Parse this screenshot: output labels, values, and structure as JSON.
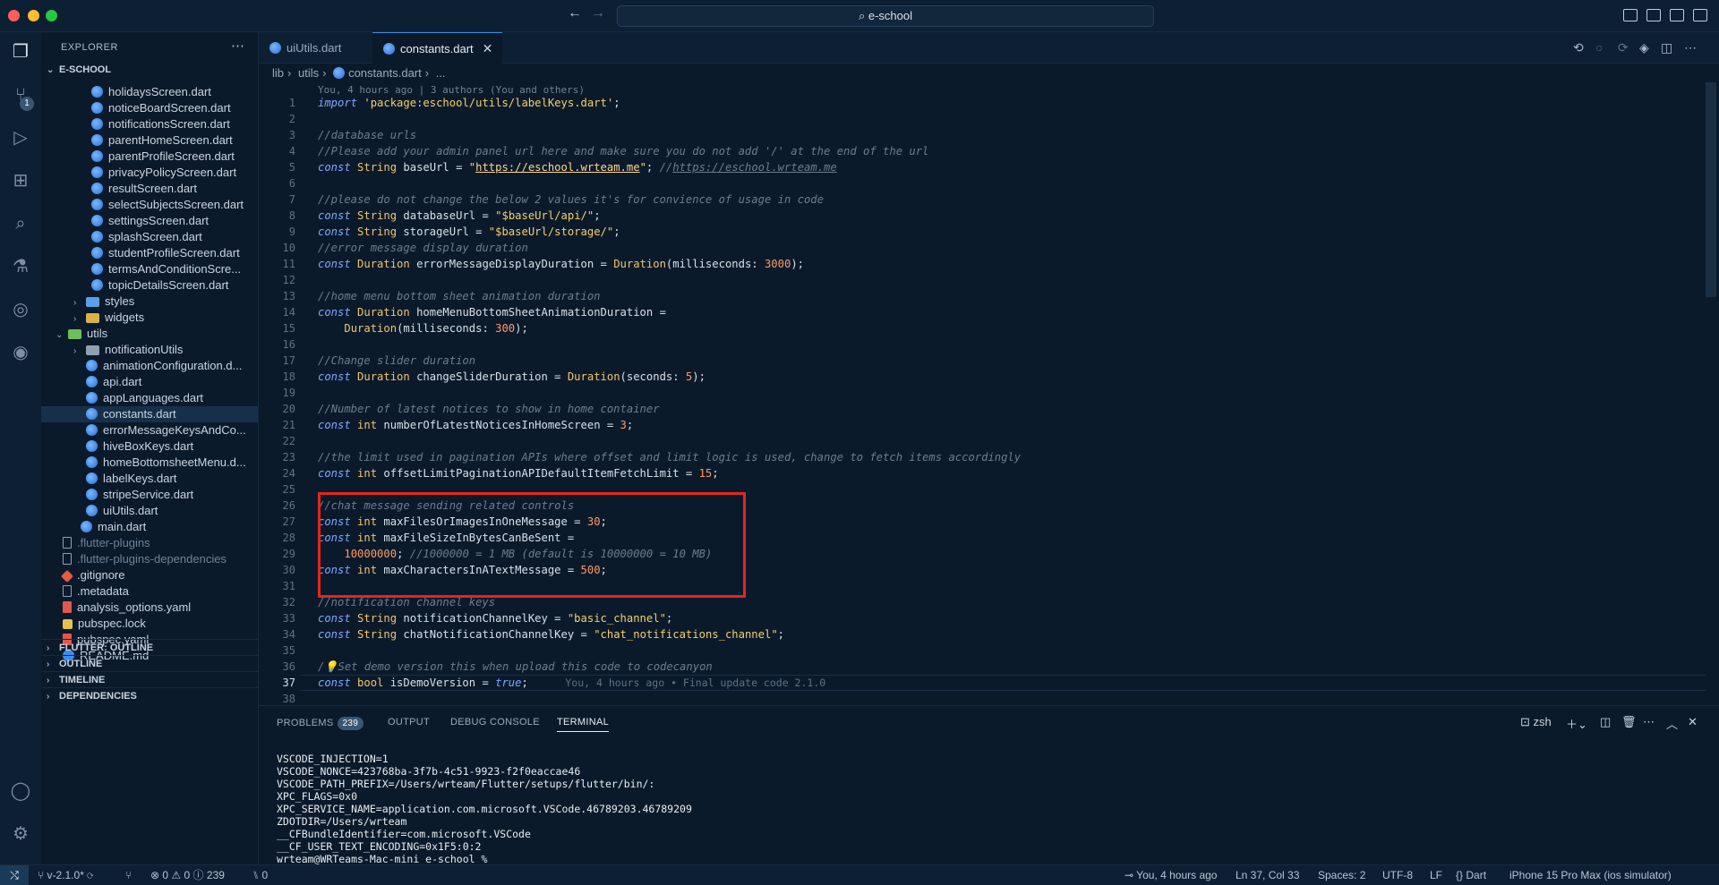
{
  "window": {
    "search": "e-school"
  },
  "explorer": {
    "title": "EXPLORER",
    "root": "E-SCHOOL",
    "items": [
      {
        "label": "holidaysScreen.dart",
        "kind": "dart",
        "indent": 2
      },
      {
        "label": "noticeBoardScreen.dart",
        "kind": "dart",
        "indent": 2
      },
      {
        "label": "notificationsScreen.dart",
        "kind": "dart",
        "indent": 2
      },
      {
        "label": "parentHomeScreen.dart",
        "kind": "dart",
        "indent": 2
      },
      {
        "label": "parentProfileScreen.dart",
        "kind": "dart",
        "indent": 2
      },
      {
        "label": "privacyPolicyScreen.dart",
        "kind": "dart",
        "indent": 2
      },
      {
        "label": "resultScreen.dart",
        "kind": "dart",
        "indent": 2
      },
      {
        "label": "selectSubjectsScreen.dart",
        "kind": "dart",
        "indent": 2
      },
      {
        "label": "settingsScreen.dart",
        "kind": "dart",
        "indent": 2
      },
      {
        "label": "splashScreen.dart",
        "kind": "dart",
        "indent": 2
      },
      {
        "label": "studentProfileScreen.dart",
        "kind": "dart",
        "indent": 2
      },
      {
        "label": "termsAndConditionScre...",
        "kind": "dart",
        "indent": 2
      },
      {
        "label": "topicDetailsScreen.dart",
        "kind": "dart",
        "indent": 2
      },
      {
        "label": "styles",
        "kind": "folder-blue",
        "indent": 1,
        "chev": "›"
      },
      {
        "label": "widgets",
        "kind": "folder-yellow",
        "indent": 1,
        "chev": "›"
      },
      {
        "label": "utils",
        "kind": "folder-green",
        "indent": 0,
        "chev": "⌄"
      },
      {
        "label": "notificationUtils",
        "kind": "folder-gray",
        "indent": 1,
        "chev": "›"
      },
      {
        "label": "animationConfiguration.d...",
        "kind": "dart",
        "indent": 1
      },
      {
        "label": "api.dart",
        "kind": "dart",
        "indent": 1
      },
      {
        "label": "appLanguages.dart",
        "kind": "dart",
        "indent": 1
      },
      {
        "label": "constants.dart",
        "kind": "dart",
        "indent": 1,
        "selected": true
      },
      {
        "label": "errorMessageKeysAndCo...",
        "kind": "dart",
        "indent": 1
      },
      {
        "label": "hiveBoxKeys.dart",
        "kind": "dart",
        "indent": 1
      },
      {
        "label": "homeBottomsheetMenu.d...",
        "kind": "dart",
        "indent": 1
      },
      {
        "label": "labelKeys.dart",
        "kind": "dart",
        "indent": 1
      },
      {
        "label": "stripeService.dart",
        "kind": "dart",
        "indent": 1
      },
      {
        "label": "uiUtils.dart",
        "kind": "dart",
        "indent": 1
      },
      {
        "label": "main.dart",
        "kind": "dart",
        "indent": -1
      },
      {
        "label": ".flutter-plugins",
        "kind": "doc",
        "indent": -2,
        "dim": true
      },
      {
        "label": ".flutter-plugins-dependencies",
        "kind": "doc",
        "indent": -2,
        "dim": true
      },
      {
        "label": ".gitignore",
        "kind": "git",
        "indent": -2
      },
      {
        "label": ".metadata",
        "kind": "doc",
        "indent": -2
      },
      {
        "label": "analysis_options.yaml",
        "kind": "red",
        "indent": -2
      },
      {
        "label": "pubspec.lock",
        "kind": "lock",
        "indent": -2
      },
      {
        "label": "pubspec.yaml",
        "kind": "red",
        "indent": -2
      },
      {
        "label": "README.md",
        "kind": "info",
        "indent": -2
      }
    ],
    "sections": [
      "FLUTTER: OUTLINE",
      "OUTLINE",
      "TIMELINE",
      "DEPENDENCIES"
    ]
  },
  "tabs": [
    {
      "label": "uiUtils.dart"
    },
    {
      "label": "constants.dart",
      "close": "✕"
    }
  ],
  "breadcrumb": [
    "lib",
    "utils",
    "constants.dart",
    "..."
  ],
  "editor": {
    "blame_top": "You, 4 hours ago | 3 authors (You and others)",
    "current_line": 37,
    "lines": [
      [
        [
          "kw",
          "import "
        ],
        [
          "str",
          "'package:eschool/utils/labelKeys.dart'"
        ],
        [
          "",
          ";"
        ]
      ],
      [],
      [
        [
          "cmt",
          "//database urls"
        ]
      ],
      [
        [
          "cmt",
          "//Please add your admin panel url here and make sure you do not add '/' at the end of the url"
        ]
      ],
      [
        [
          "kw",
          "const "
        ],
        [
          "ty",
          "String "
        ],
        [
          "",
          "baseUrl = "
        ],
        [
          "strb",
          "\""
        ],
        [
          "strb url",
          "https://eschool.wrteam.me"
        ],
        [
          "strb",
          "\""
        ],
        [
          "",
          "; "
        ],
        [
          "cmt",
          "//"
        ],
        [
          "cmt url",
          "https://eschool.wrteam.me"
        ]
      ],
      [],
      [
        [
          "cmt",
          "//please do not change the below 2 values it's for convience of usage in code"
        ]
      ],
      [
        [
          "kw",
          "const "
        ],
        [
          "ty",
          "String "
        ],
        [
          "",
          "databaseUrl = "
        ],
        [
          "str",
          "\"$baseUrl/api/\""
        ],
        [
          "",
          ";"
        ]
      ],
      [
        [
          "kw",
          "const "
        ],
        [
          "ty",
          "String "
        ],
        [
          "",
          "storageUrl = "
        ],
        [
          "str",
          "\"$baseUrl/storage/\""
        ],
        [
          "",
          ";"
        ]
      ],
      [
        [
          "cmt",
          "//error message display duration"
        ]
      ],
      [
        [
          "kw",
          "const "
        ],
        [
          "ty",
          "Duration "
        ],
        [
          "",
          "errorMessageDisplayDuration = "
        ],
        [
          "fn",
          "Duration"
        ],
        [
          "",
          "(milliseconds: "
        ],
        [
          "num",
          "3000"
        ],
        [
          "",
          ");"
        ]
      ],
      [],
      [
        [
          "cmt",
          "//home menu bottom sheet animation duration"
        ]
      ],
      [
        [
          "kw",
          "const "
        ],
        [
          "ty",
          "Duration "
        ],
        [
          "",
          "homeMenuBottomSheetAnimationDuration ="
        ]
      ],
      [
        [
          "",
          "    "
        ],
        [
          "fn",
          "Duration"
        ],
        [
          "",
          "(milliseconds: "
        ],
        [
          "num",
          "300"
        ],
        [
          "",
          ");"
        ]
      ],
      [],
      [
        [
          "cmt",
          "//Change slider duration"
        ]
      ],
      [
        [
          "kw",
          "const "
        ],
        [
          "ty",
          "Duration "
        ],
        [
          "",
          "changeSliderDuration = "
        ],
        [
          "fn",
          "Duration"
        ],
        [
          "",
          "(seconds: "
        ],
        [
          "num",
          "5"
        ],
        [
          "",
          ");"
        ]
      ],
      [],
      [
        [
          "cmt",
          "//Number of latest notices to show in home container"
        ]
      ],
      [
        [
          "kw",
          "const "
        ],
        [
          "ty",
          "int "
        ],
        [
          "",
          "numberOfLatestNoticesInHomeScreen = "
        ],
        [
          "num",
          "3"
        ],
        [
          "",
          ";"
        ]
      ],
      [],
      [
        [
          "cmt",
          "//the limit used in pagination APIs where offset and limit logic is used, change to fetch items accordingly"
        ]
      ],
      [
        [
          "kw",
          "const "
        ],
        [
          "ty",
          "int "
        ],
        [
          "",
          "offsetLimitPaginationAPIDefaultItemFetchLimit = "
        ],
        [
          "num",
          "15"
        ],
        [
          "",
          ";"
        ]
      ],
      [],
      [
        [
          "cmt",
          "//chat message sending related controls"
        ]
      ],
      [
        [
          "kw",
          "const "
        ],
        [
          "ty",
          "int "
        ],
        [
          "",
          "maxFilesOrImagesInOneMessage = "
        ],
        [
          "num",
          "30"
        ],
        [
          "",
          ";"
        ]
      ],
      [
        [
          "kw",
          "const "
        ],
        [
          "ty",
          "int "
        ],
        [
          "",
          "maxFileSizeInBytesCanBeSent ="
        ]
      ],
      [
        [
          "",
          "    "
        ],
        [
          "num",
          "10000000"
        ],
        [
          "",
          "; "
        ],
        [
          "cmt",
          "//1000000 = 1 MB (default is 10000000 = 10 MB)"
        ]
      ],
      [
        [
          "kw",
          "const "
        ],
        [
          "ty",
          "int "
        ],
        [
          "",
          "maxCharactersInATextMessage = "
        ],
        [
          "num",
          "500"
        ],
        [
          "",
          ";"
        ]
      ],
      [],
      [
        [
          "cmt",
          "//notification channel keys"
        ]
      ],
      [
        [
          "kw",
          "const "
        ],
        [
          "ty",
          "String "
        ],
        [
          "",
          "notificationChannelKey = "
        ],
        [
          "str",
          "\"basic_channel\""
        ],
        [
          "",
          ";"
        ]
      ],
      [
        [
          "kw",
          "const "
        ],
        [
          "ty",
          "String "
        ],
        [
          "",
          "chatNotificationChannelKey = "
        ],
        [
          "str",
          "\"chat_notifications_channel\""
        ],
        [
          "",
          ";"
        ]
      ],
      [],
      [
        [
          "cmt",
          "/💡Set demo version this when upload this code to codecanyon"
        ]
      ],
      [
        [
          "kw",
          "const "
        ],
        [
          "ty",
          "bool "
        ],
        [
          "",
          "isDemoVersion = "
        ],
        [
          "kw",
          "true"
        ],
        [
          "",
          ";"
        ],
        [
          "blame-inline",
          "      You, 4 hours ago • Final update code 2.1.0"
        ]
      ],
      []
    ]
  },
  "panel": {
    "tabs": [
      "PROBLEMS",
      "OUTPUT",
      "DEBUG CONSOLE",
      "TERMINAL"
    ],
    "problems_count": "239",
    "shell": "zsh",
    "terminal_lines": [
      "VSCODE_INJECTION=1",
      "VSCODE_NONCE=423768ba-3f7b-4c51-9923-f2f0eaccae46",
      "VSCODE_PATH_PREFIX=/Users/wrteam/Flutter/setups/flutter/bin/:",
      "XPC_FLAGS=0x0",
      "XPC_SERVICE_NAME=application.com.microsoft.VSCode.46789203.46789209",
      "ZDOTDIR=/Users/wrteam",
      "__CFBundleIdentifier=com.microsoft.VSCode",
      "__CF_USER_TEXT_ENCODING=0x1F5:0:2",
      "wrteam@WRTeams-Mac-mini e-school %"
    ]
  },
  "status": {
    "branch": "v-2.1.0*",
    "errors": "0",
    "warnings": "0",
    "infos": "239",
    "ports": "0",
    "blame": "You, 4 hours ago",
    "position": "Ln 37, Col 33",
    "spaces": "Spaces: 2",
    "encoding": "UTF-8",
    "eol": "LF",
    "language": "Dart",
    "device": "iPhone 15 Pro Max (ios simulator)"
  },
  "colors": {
    "accent": "#3b8eea",
    "highlight_box": "#e3271a"
  }
}
